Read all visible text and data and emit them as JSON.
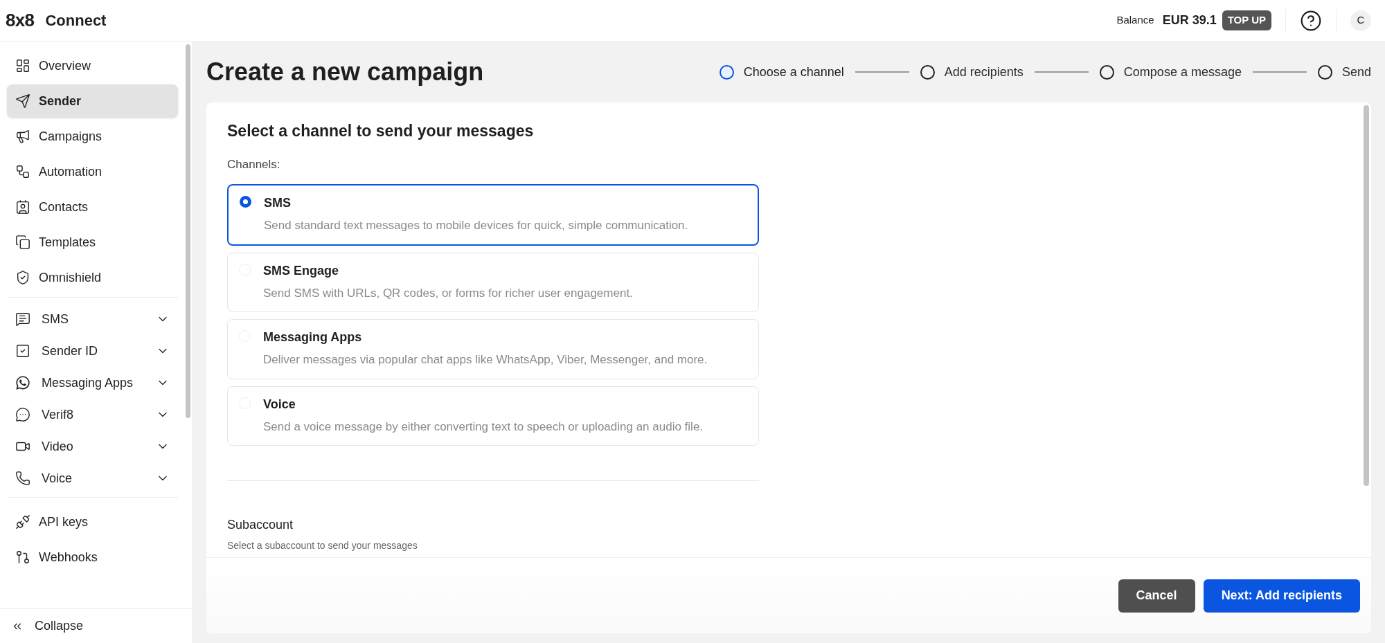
{
  "brand": {
    "logo": "8x8",
    "name": "Connect"
  },
  "header": {
    "balance_label": "Balance",
    "balance": "EUR 39.1",
    "top_up": "TOP UP",
    "avatar": "C"
  },
  "sidebar": {
    "sections": [
      [
        {
          "label": "Overview",
          "kind": "link",
          "selected": false
        },
        {
          "label": "Sender",
          "kind": "link",
          "selected": true
        },
        {
          "label": "Campaigns",
          "kind": "link",
          "selected": false
        },
        {
          "label": "Automation",
          "kind": "link",
          "selected": false
        },
        {
          "label": "Contacts",
          "kind": "link",
          "selected": false
        },
        {
          "label": "Templates",
          "kind": "link",
          "selected": false
        },
        {
          "label": "Omnishield",
          "kind": "link",
          "selected": false
        }
      ],
      [
        {
          "label": "SMS",
          "kind": "group",
          "expanded": false
        },
        {
          "label": "Sender ID",
          "kind": "group",
          "expanded": false
        },
        {
          "label": "Messaging Apps",
          "kind": "group",
          "expanded": false
        },
        {
          "label": "Verif8",
          "kind": "group",
          "expanded": false
        },
        {
          "label": "Video",
          "kind": "group",
          "expanded": false
        },
        {
          "label": "Voice",
          "kind": "group",
          "expanded": false
        }
      ],
      [
        {
          "label": "API keys",
          "kind": "link",
          "selected": false
        },
        {
          "label": "Webhooks",
          "kind": "link",
          "selected": false
        }
      ]
    ],
    "collapse": "Collapse"
  },
  "page": {
    "title": "Create a new campaign",
    "steps": [
      {
        "label": "Choose a channel",
        "selected": true
      },
      {
        "label": "Add recipients",
        "selected": false
      },
      {
        "label": "Compose a message",
        "selected": false
      },
      {
        "label": "Send",
        "selected": false
      }
    ],
    "heading": "Select a channel to send your messages",
    "channels_label": "Channels:",
    "channels": [
      {
        "name": "SMS",
        "description": "Send standard text messages to mobile devices for quick, simple communication.",
        "selected": true
      },
      {
        "name": "SMS Engage",
        "description": "Send SMS with URLs, QR codes, or forms for richer user engagement.",
        "selected": false
      },
      {
        "name": "Messaging Apps",
        "description": "Deliver messages via popular chat apps like WhatsApp, Viber, Messenger, and more.",
        "selected": false
      },
      {
        "name": "Voice",
        "description": "Send a voice message by either converting text to speech or uploading an audio file.",
        "selected": false
      }
    ],
    "subaccount": {
      "label": "Subaccount",
      "hint": "Select a subaccount to send your messages"
    },
    "buttons": {
      "cancel": "Cancel",
      "next": "Next: Add recipients"
    }
  }
}
